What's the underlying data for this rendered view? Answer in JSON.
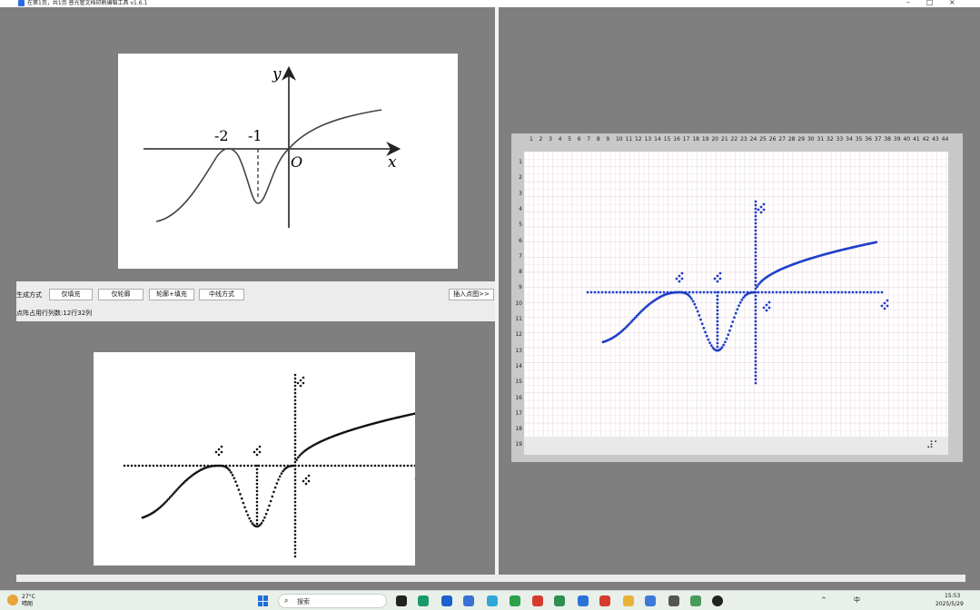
{
  "window": {
    "title": "在第1页，共1页 普光管文档印刷编辑工具 v1.6.1",
    "controls": {
      "minimize": "–",
      "maximize": "□",
      "close": "×"
    }
  },
  "figure_labels": {
    "y": "y",
    "x": "x",
    "origin": "O",
    "neg2": "-2",
    "neg1": "-1"
  },
  "toolbar": {
    "mode_label": "生成方式",
    "btn_fill_only": "仅填充",
    "btn_outline_only": "仅轮廓",
    "btn_outline_fill": "轮廓+填充",
    "btn_midline": "中线方式",
    "btn_insert": "插入点图>>",
    "status": "点阵占用行列数:12行32列"
  },
  "grid": {
    "columns": [
      "1",
      "2",
      "3",
      "4",
      "5",
      "6",
      "7",
      "8",
      "9",
      "10",
      "11",
      "12",
      "13",
      "14",
      "15",
      "16",
      "17",
      "18",
      "19",
      "20",
      "21",
      "22",
      "23",
      "24",
      "25",
      "26",
      "27",
      "28",
      "29",
      "30",
      "31",
      "32",
      "33",
      "34",
      "35",
      "36",
      "37",
      "38",
      "39",
      "40",
      "41",
      "42",
      "43",
      "44"
    ],
    "rows": [
      "1",
      "2",
      "3",
      "4",
      "5",
      "6",
      "7",
      "8",
      "9",
      "10",
      "11",
      "12",
      "13",
      "14",
      "15",
      "16",
      "17",
      "18",
      "19"
    ],
    "corner_mark": "⠼⠁"
  },
  "taskbar": {
    "weather_temp": "27°C",
    "weather_desc": "晴朗",
    "search_placeholder": "搜索",
    "tray_lang": "中",
    "time": "15:53",
    "date": "2025/5/29"
  },
  "colors": {
    "accent_blue": "#1f3fc8",
    "braille_black": "#111111",
    "window_bg": "#7f7f7f"
  }
}
